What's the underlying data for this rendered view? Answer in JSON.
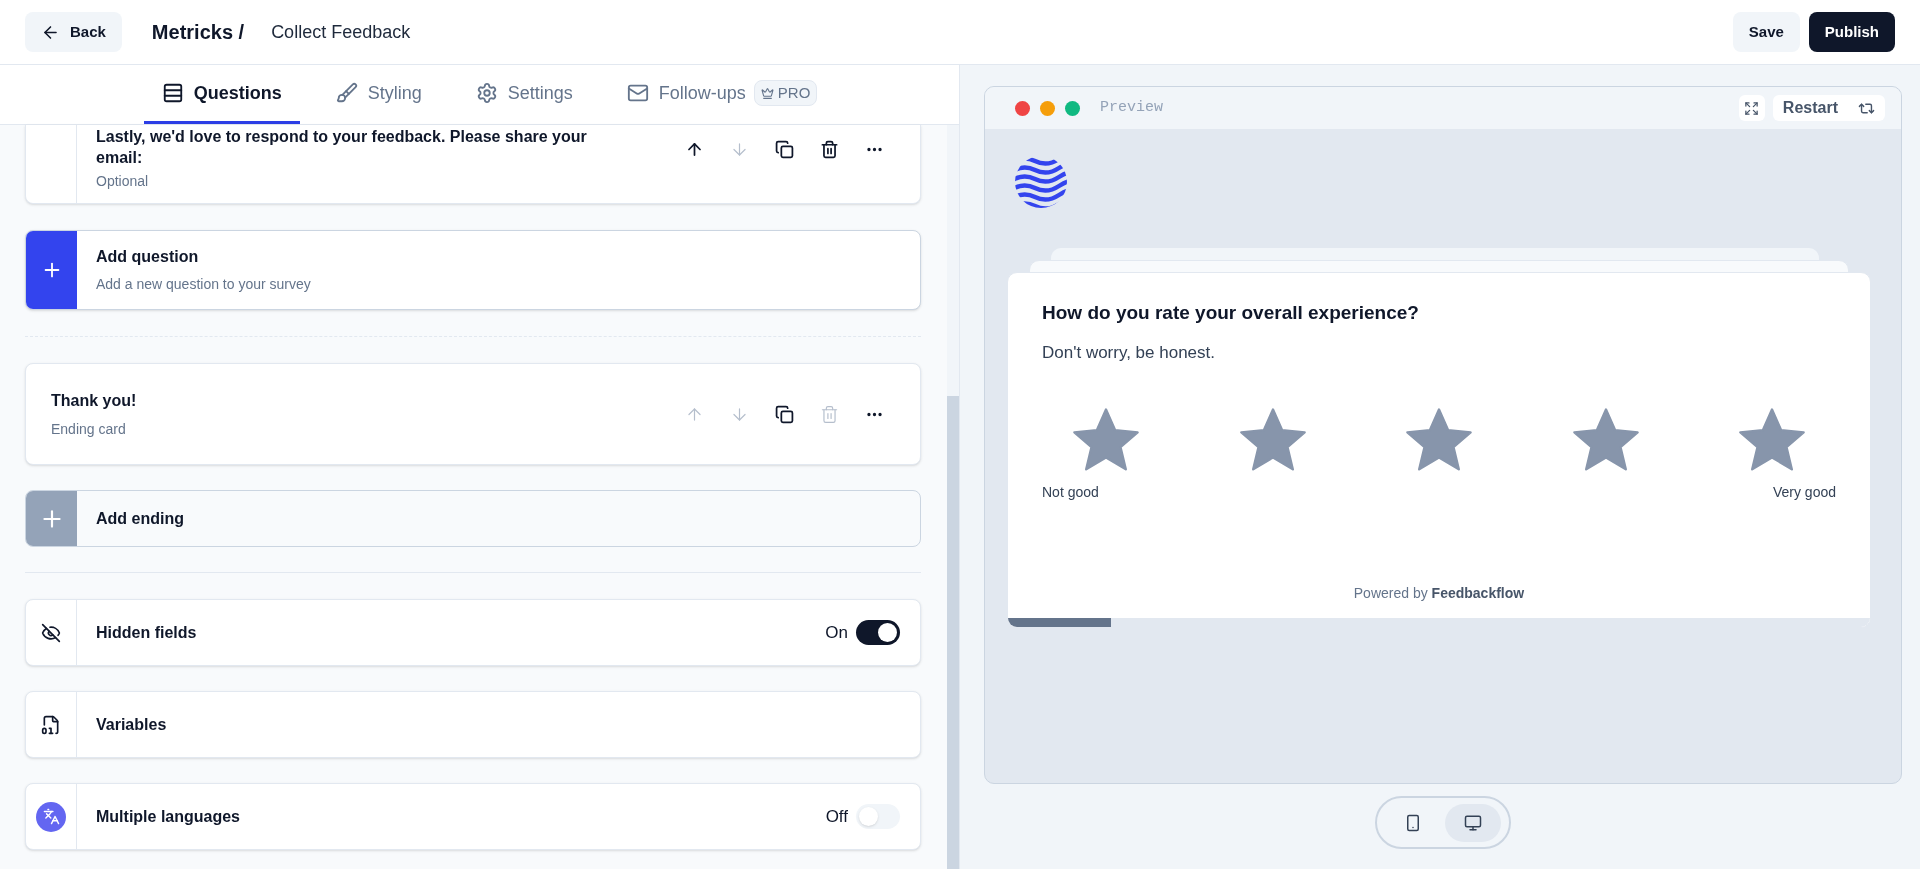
{
  "header": {
    "back": "Back",
    "workspace": "Metricks /",
    "survey": "Collect Feedback",
    "save": "Save",
    "publish": "Publish"
  },
  "tabs": [
    {
      "kind": "questions",
      "label": "Questions",
      "selected": true
    },
    {
      "kind": "styling",
      "label": "Styling",
      "selected": false
    },
    {
      "kind": "settings",
      "label": "Settings",
      "selected": false
    },
    {
      "kind": "followups",
      "label": "Follow-ups",
      "badge": "PRO",
      "selected": false
    }
  ],
  "question_card": {
    "title": "Lastly, we'd love to respond to your feedback. Please share your email:",
    "subtitle": "Optional",
    "actions": [
      {
        "kind": "up",
        "disabled": false
      },
      {
        "kind": "down",
        "disabled": true
      },
      {
        "kind": "copy",
        "disabled": false
      },
      {
        "kind": "delete",
        "disabled": false
      },
      {
        "kind": "more",
        "disabled": false
      }
    ]
  },
  "add_question": {
    "title": "Add question",
    "subtitle": "Add a new question to your survey"
  },
  "ending_card": {
    "title": "Thank you!",
    "subtitle": "Ending card",
    "actions": [
      {
        "kind": "up",
        "disabled": true
      },
      {
        "kind": "down",
        "disabled": true
      },
      {
        "kind": "copy",
        "disabled": false
      },
      {
        "kind": "delete",
        "disabled": true
      },
      {
        "kind": "more",
        "disabled": false
      }
    ]
  },
  "add_ending": {
    "title": "Add ending"
  },
  "options": [
    {
      "kind": "hidden",
      "label": "Hidden fields",
      "toggle": {
        "label": "On",
        "on": true
      }
    },
    {
      "kind": "variables",
      "label": "Variables"
    },
    {
      "kind": "languages",
      "label": "Multiple languages",
      "toggle": {
        "label": "Off",
        "on": false
      }
    }
  ],
  "preview": {
    "title": "Preview",
    "restart": "Restart",
    "question": "How do you rate your overall experience?",
    "subtitle": "Don't worry, be honest.",
    "rating": {
      "lower_label": "Not good",
      "upper_label": "Very good",
      "options": [
        {
          "selected": false
        },
        {
          "selected": false
        },
        {
          "selected": false
        },
        {
          "selected": false
        },
        {
          "selected": false
        }
      ]
    },
    "powered": "Powered by **Feedbackflow**",
    "progress": {
      "level": 0.12
    }
  },
  "devices": [
    {
      "kind": "phone",
      "selected": false
    },
    {
      "kind": "desktop",
      "selected": true
    }
  ]
}
